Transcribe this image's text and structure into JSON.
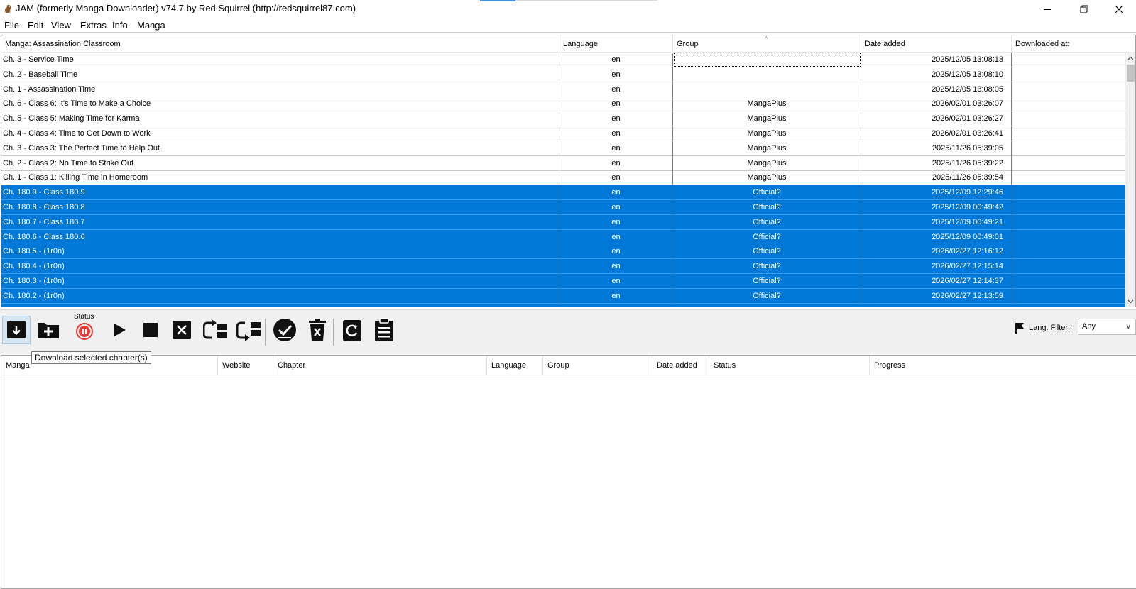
{
  "window": {
    "title": "JAM (formerly Manga Downloader) v74.7 by Red Squirrel (http://redsquirrel87.com)",
    "app_icon": "squirrel-icon",
    "controls": [
      "minimize-icon",
      "maximize-icon",
      "close-icon"
    ]
  },
  "menu": {
    "items": [
      "File",
      "Edit",
      "View",
      "Extras",
      "Info",
      "Manga"
    ]
  },
  "chapters": {
    "headers": {
      "name": "Manga: Assassination Classroom",
      "language": "Language",
      "group": "Group",
      "date_added": "Date added",
      "downloaded_at": "Downloaded at:"
    },
    "rows": [
      {
        "name": "Ch. 3 - Service Time",
        "language": "en",
        "group": "",
        "date": "2025/12/05 13:08:13",
        "downloaded": "",
        "selected": false
      },
      {
        "name": "Ch. 2 - Baseball Time",
        "language": "en",
        "group": "",
        "date": "2025/12/05 13:08:10",
        "downloaded": "",
        "selected": false
      },
      {
        "name": "Ch. 1 - Assassination Time",
        "language": "en",
        "group": "",
        "date": "2025/12/05 13:08:05",
        "downloaded": "",
        "selected": false
      },
      {
        "name": "Ch. 6 - Class 6: It's Time to Make a Choice",
        "language": "en",
        "group": "MangaPlus",
        "date": "2026/02/01 03:26:07",
        "downloaded": "",
        "selected": false
      },
      {
        "name": "Ch. 5 - Class 5: Making Time for Karma",
        "language": "en",
        "group": "MangaPlus",
        "date": "2026/02/01 03:26:27",
        "downloaded": "",
        "selected": false
      },
      {
        "name": "Ch. 4 - Class 4: Time to Get Down to Work",
        "language": "en",
        "group": "MangaPlus",
        "date": "2026/02/01 03:26:41",
        "downloaded": "",
        "selected": false
      },
      {
        "name": "Ch. 3 - Class 3: The Perfect Time to Help Out",
        "language": "en",
        "group": "MangaPlus",
        "date": "2025/11/26 05:39:05",
        "downloaded": "",
        "selected": false
      },
      {
        "name": "Ch. 2 - Class 2: No Time to Strike Out",
        "language": "en",
        "group": "MangaPlus",
        "date": "2025/11/26 05:39:22",
        "downloaded": "",
        "selected": false
      },
      {
        "name": "Ch. 1 - Class 1: Killing Time in Homeroom",
        "language": "en",
        "group": "MangaPlus",
        "date": "2025/11/26 05:39:54",
        "downloaded": "",
        "selected": false
      },
      {
        "name": "Ch. 180.9 - Class 180.9",
        "language": "en",
        "group": "Official?",
        "date": "2025/12/09 12:29:46",
        "downloaded": "",
        "selected": true
      },
      {
        "name": "Ch. 180.8 - Class 180.8",
        "language": "en",
        "group": "Official?",
        "date": "2025/12/09 00:49:42",
        "downloaded": "",
        "selected": true
      },
      {
        "name": "Ch. 180.7 - Class 180.7",
        "language": "en",
        "group": "Official?",
        "date": "2025/12/09 00:49:21",
        "downloaded": "",
        "selected": true
      },
      {
        "name": "Ch. 180.6 - Class 180.6",
        "language": "en",
        "group": "Official?",
        "date": "2025/12/09 00:49:01",
        "downloaded": "",
        "selected": true
      },
      {
        "name": "Ch. 180.5 - (1r0n)",
        "language": "en",
        "group": "Official?",
        "date": "2026/02/27 12:16:12",
        "downloaded": "",
        "selected": true
      },
      {
        "name": "Ch. 180.4 - (1r0n)",
        "language": "en",
        "group": "Official?",
        "date": "2026/02/27 12:15:14",
        "downloaded": "",
        "selected": true
      },
      {
        "name": "Ch. 180.3 - (1r0n)",
        "language": "en",
        "group": "Official?",
        "date": "2026/02/27 12:14:37",
        "downloaded": "",
        "selected": true
      },
      {
        "name": "Ch. 180.2 - (1r0n)",
        "language": "en",
        "group": "Official?",
        "date": "2026/02/27 12:13:59",
        "downloaded": "",
        "selected": true
      }
    ]
  },
  "toolbar": {
    "status_label": "Status",
    "tooltip": "Download selected chapter(s)",
    "buttons": [
      "download-selected-icon",
      "add-folder-icon",
      "status-pause-icon",
      "play-icon",
      "stop-icon",
      "remove-icon",
      "move-up-icon",
      "move-down-icon",
      "mark-read-icon",
      "delete-icon",
      "refresh-icon",
      "clipboard-icon"
    ],
    "lang_filter_label": "Lang. Filter:",
    "lang_filter_value": "Any"
  },
  "queue": {
    "headers": [
      "Manga",
      "Website",
      "Chapter",
      "Language",
      "Group",
      "Date added",
      "Status",
      "Progress"
    ]
  },
  "colors": {
    "selection": "#0078d7",
    "status_red": "#e53935",
    "toolbar_bg": "#f0f0f0"
  }
}
